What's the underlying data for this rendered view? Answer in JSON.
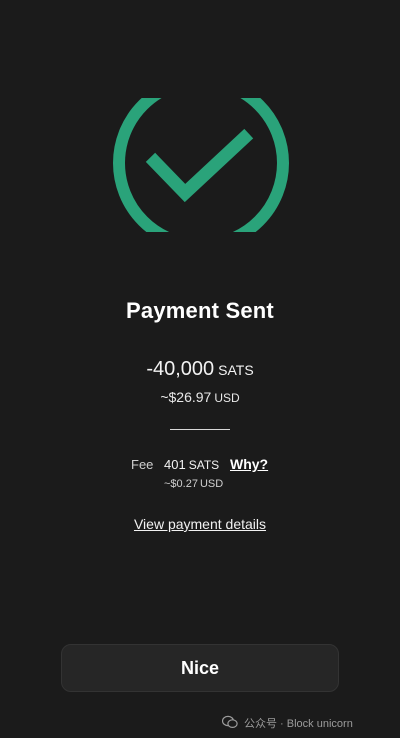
{
  "status": {
    "title": "Payment Sent",
    "icon": "check-circle-icon",
    "accent_color": "#2aa37a"
  },
  "amount": {
    "value": "-40,000",
    "unit": "SATS",
    "fiat_value": "~$26.97",
    "fiat_unit": "USD"
  },
  "fee": {
    "label": "Fee",
    "value": "401",
    "unit": "SATS",
    "why_label": "Why?",
    "fiat_value": "~$0.27",
    "fiat_unit": "USD"
  },
  "links": {
    "details": "View payment details"
  },
  "actions": {
    "primary_label": "Nice"
  },
  "watermark": {
    "icon": "wechat-icon",
    "text": "公众号 · Block unicorn"
  }
}
